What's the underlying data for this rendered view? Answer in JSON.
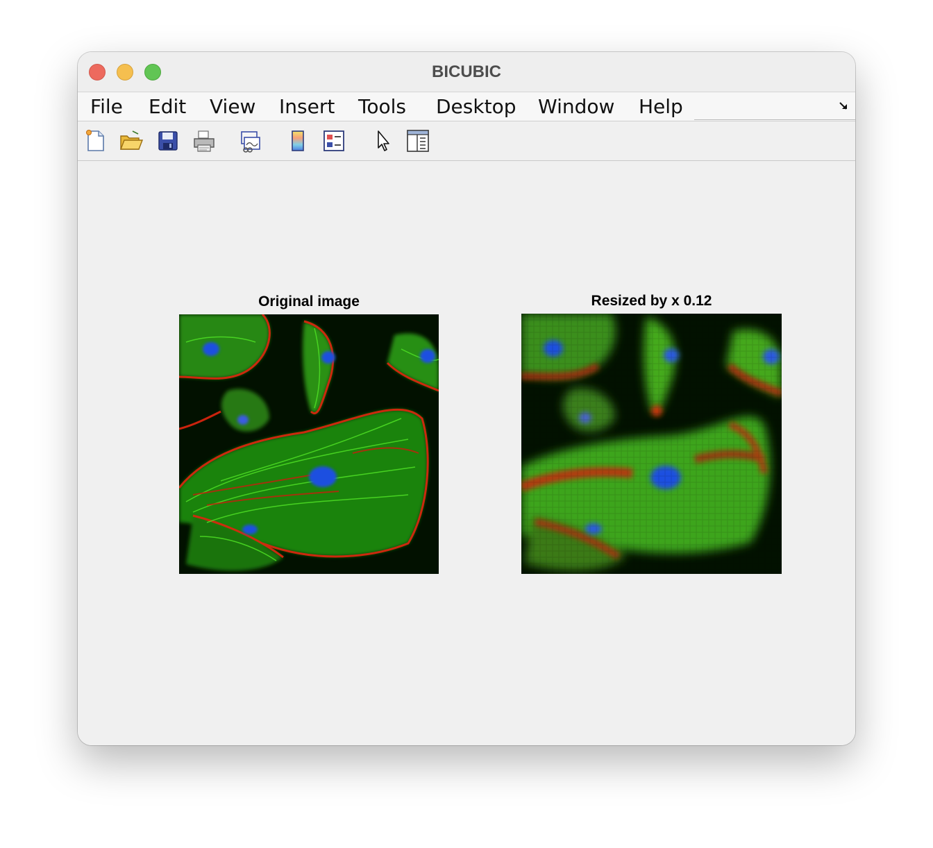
{
  "window": {
    "title": "BICUBIC"
  },
  "menu": {
    "items": [
      "File",
      "Edit",
      "View",
      "Insert",
      "Tools",
      "Desktop",
      "Window",
      "Help"
    ]
  },
  "toolbar": {
    "tools": [
      "new-figure-icon",
      "open-file-icon",
      "save-icon",
      "print-icon",
      "link-plot-icon",
      "colorbar-icon",
      "legend-icon",
      "edit-plot-pointer-icon",
      "property-editor-icon"
    ]
  },
  "figure": {
    "left_axes": {
      "title": "Original image"
    },
    "right_axes": {
      "title": "Resized by x 0.12"
    }
  },
  "colors": {
    "window_bg": "#f0f0f0",
    "image_bg": "#021100",
    "actin": "#e0260f",
    "tubulin": "#3fd21a",
    "nuclei": "#1f4fe0"
  }
}
